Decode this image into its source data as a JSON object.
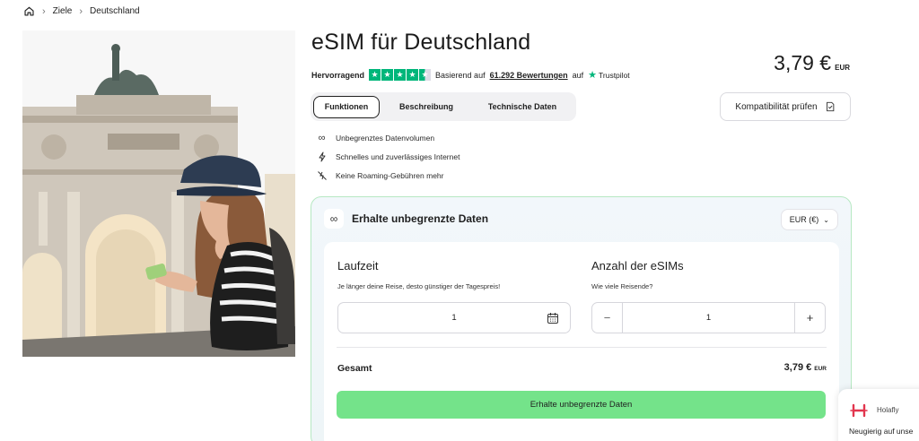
{
  "breadcrumb": {
    "home_icon": "home-icon",
    "items": [
      "Ziele",
      "Deutschland"
    ]
  },
  "product": {
    "title": "eSIM für Deutschland",
    "price": "3,79 €",
    "currency": "EUR"
  },
  "rating": {
    "label": "Hervorragend",
    "stars": 4.5,
    "based_on": "Basierend auf",
    "reviews": "61.292 Bewertungen",
    "on": "auf",
    "provider": "Trustpilot"
  },
  "tabs": [
    "Funktionen",
    "Beschreibung",
    "Technische Daten"
  ],
  "compat_button": "Kompatibilität prüfen",
  "features": [
    {
      "icon": "infinity-icon",
      "text": "Unbegrenztes Datenvolumen"
    },
    {
      "icon": "lightning-icon",
      "text": "Schnelles und zuverlässiges Internet"
    },
    {
      "icon": "no-roaming-icon",
      "text": "Keine Roaming-Gebühren mehr"
    }
  ],
  "card": {
    "title": "Erhalte unbegrenzte Daten",
    "currency_select": "EUR (€)",
    "duration": {
      "title": "Laufzeit",
      "subtitle": "Je länger deine Reise, desto günstiger der Tagespreis!",
      "value": "1"
    },
    "esims": {
      "title": "Anzahl der eSIMs",
      "subtitle": "Wie viele Reisende?",
      "value": "1",
      "minus": "−",
      "plus": "+"
    },
    "total_label": "Gesamt",
    "total_price": "3,79 €",
    "total_currency": "EUR",
    "cta": "Erhalte unbegrenzte Daten"
  },
  "chat": {
    "brand": "Holafly",
    "message": "Neugierig auf unse"
  },
  "colors": {
    "accent_green": "#74e38a",
    "trustpilot_green": "#00b67a",
    "card_border": "#b6e8c2",
    "holafly_red": "#e2364e"
  }
}
